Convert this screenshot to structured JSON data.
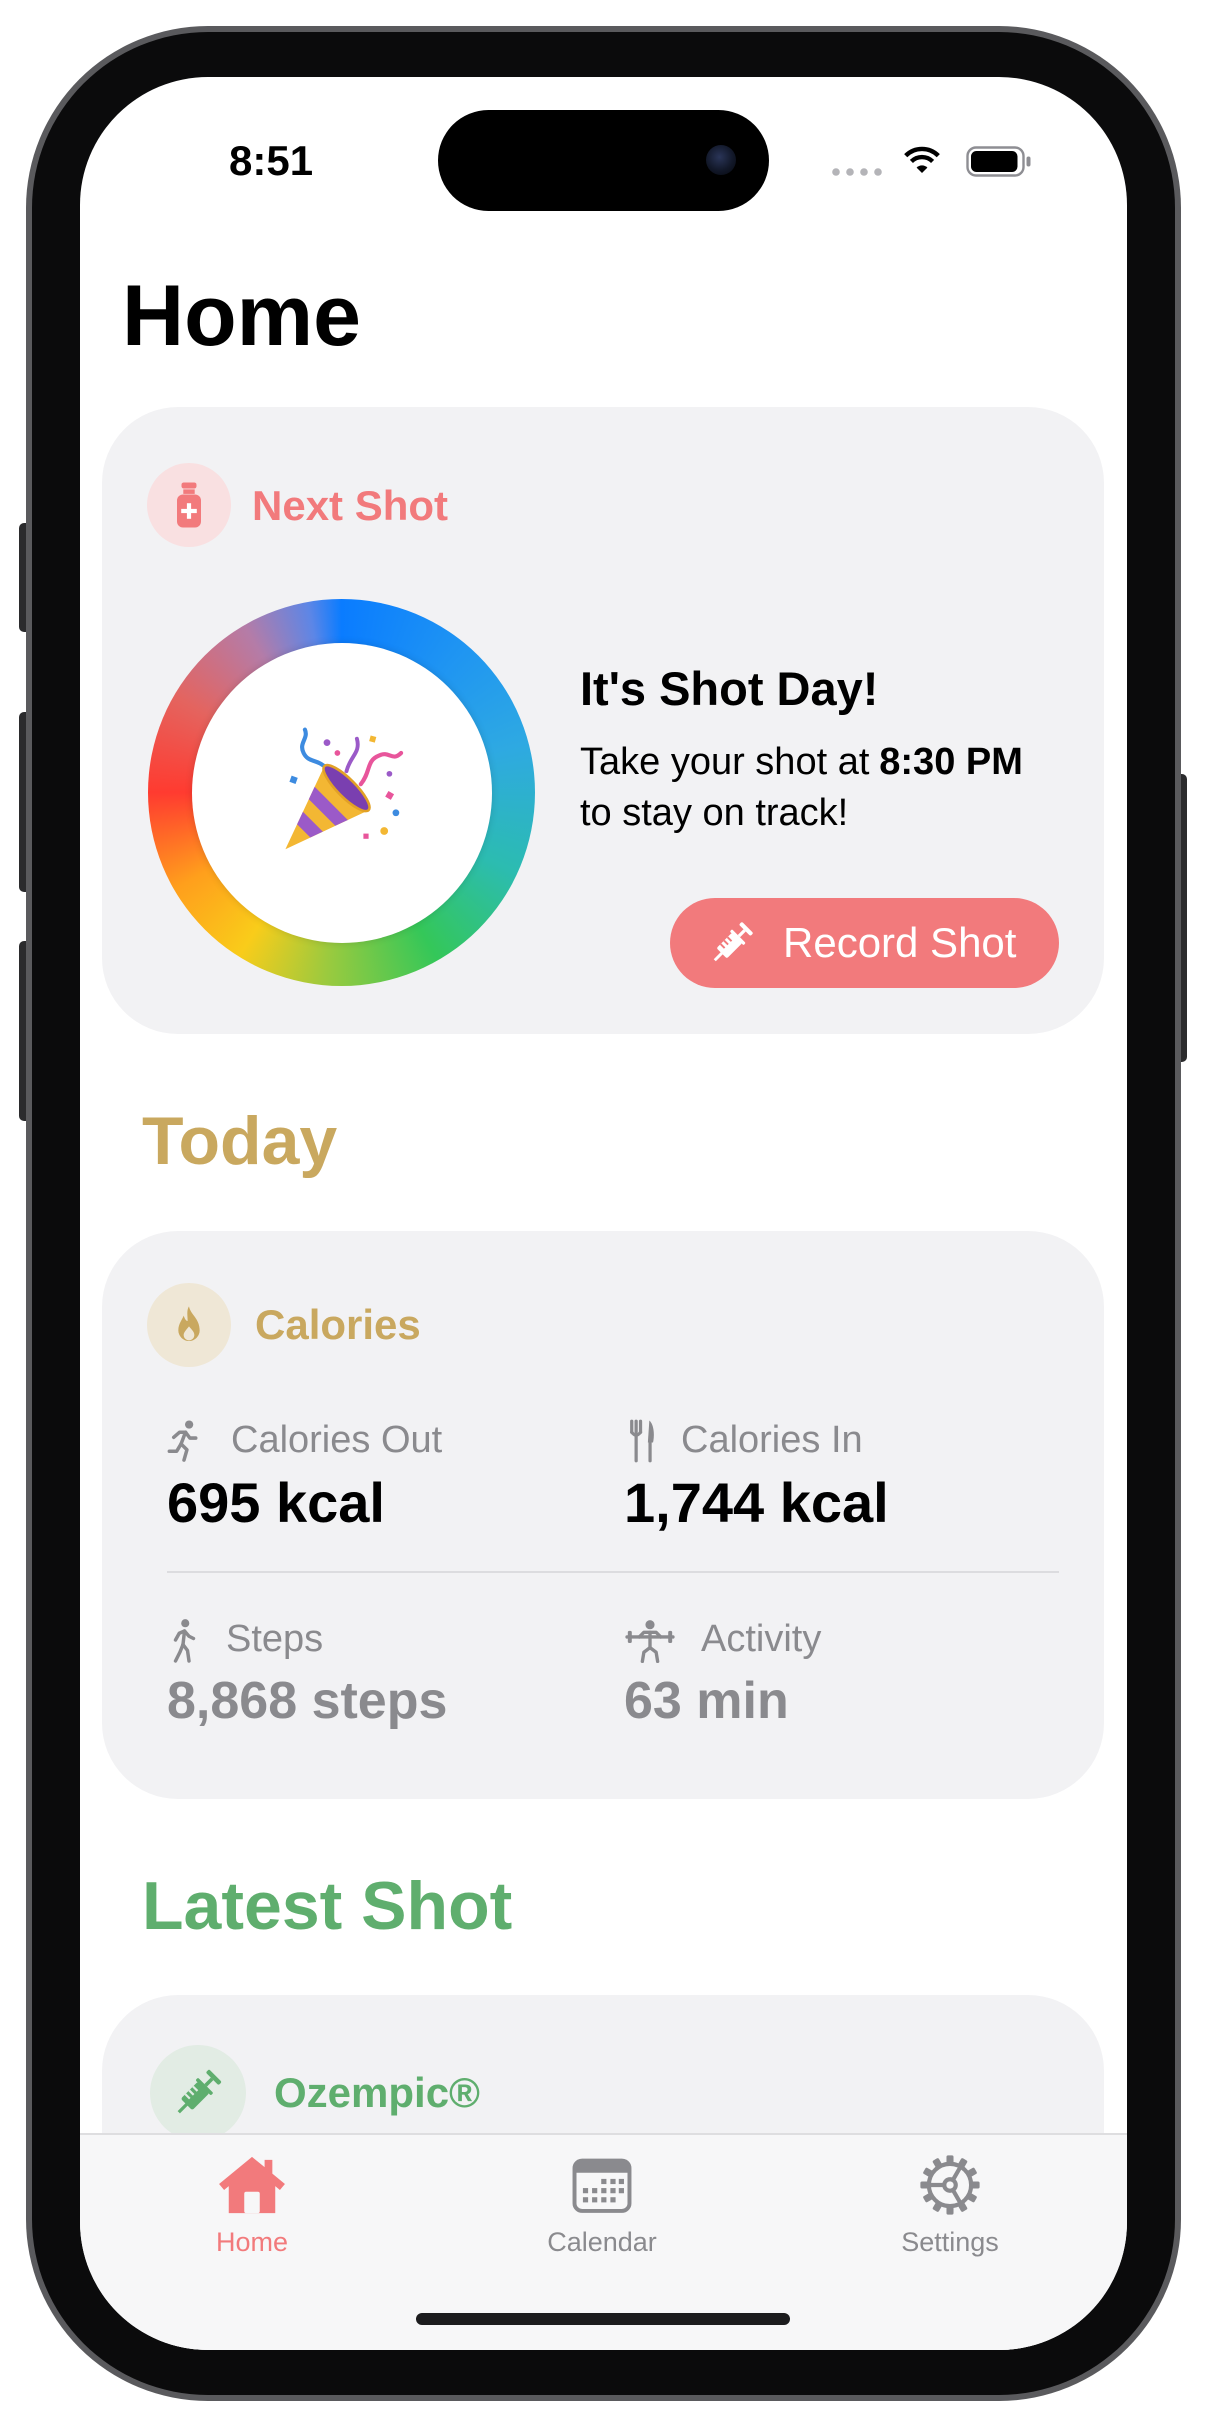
{
  "status_bar": {
    "time": "8:51",
    "icons": [
      "cellular-dots-icon",
      "wifi-icon",
      "battery-icon"
    ],
    "battery_level": 0.95
  },
  "page": {
    "title": "Home"
  },
  "next_shot": {
    "label": "Next Shot",
    "icon": "vial-icon",
    "ring_icon": "party-popper-icon",
    "heading": "It's Shot Day!",
    "message_prefix": "Take your shot at",
    "message_time": "8:30 PM",
    "message_suffix": "to stay on track!",
    "button": {
      "label": "Record Shot",
      "icon": "syringe-icon"
    }
  },
  "today": {
    "section_title": "Today",
    "calories_card": {
      "title": "Calories",
      "icon": "flame-icon",
      "metrics": [
        {
          "label": "Calories Out",
          "value": "695 kcal",
          "icon": "figure-run-icon"
        },
        {
          "label": "Calories In",
          "value": "1,744 kcal",
          "icon": "fork-knife-icon"
        },
        {
          "label": "Steps",
          "value": "8,868 steps",
          "icon": "figure-walk-icon"
        },
        {
          "label": "Activity",
          "value": "63 min",
          "icon": "weightlifter-icon"
        }
      ]
    }
  },
  "latest_shot": {
    "section_title": "Latest Shot",
    "medication": "Ozempic®",
    "icon": "syringe-icon"
  },
  "tab_bar": {
    "tabs": [
      {
        "label": "Home",
        "icon": "house-icon",
        "selected": true
      },
      {
        "label": "Calendar",
        "icon": "calendar-icon",
        "selected": false
      },
      {
        "label": "Settings",
        "icon": "gear-icon",
        "selected": false
      }
    ]
  },
  "colors": {
    "accent": "#f27a7c",
    "gold": "#c9a85f",
    "green": "#5fae6e",
    "secondary_text": "#8a8a8e",
    "card_background": "#f2f2f4"
  }
}
